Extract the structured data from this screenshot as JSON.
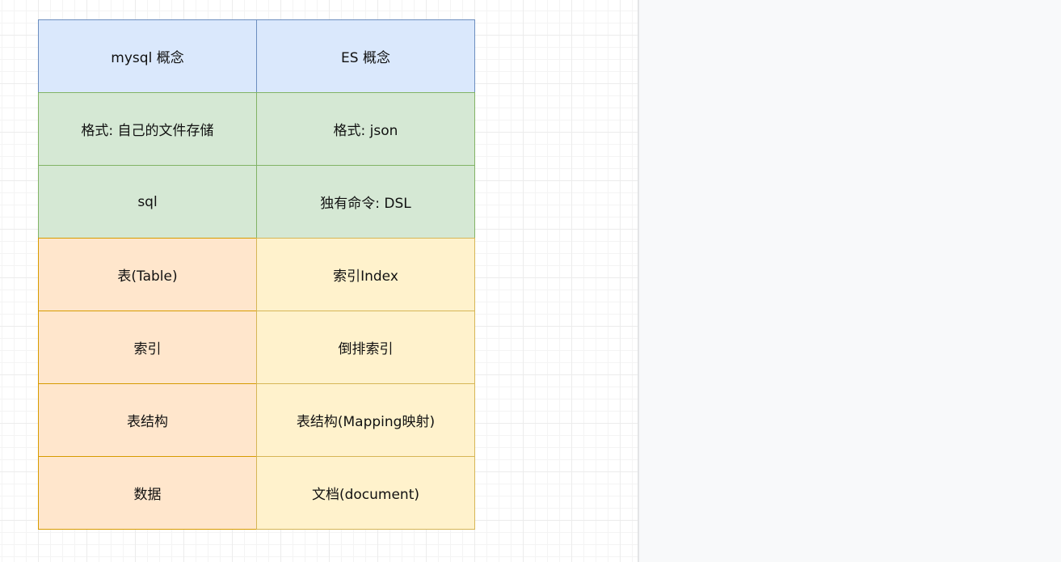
{
  "diagram": {
    "cells": {
      "mysql_header": "mysql  概念",
      "es_header": "ES 概念",
      "mysql_format": "格式: 自己的文件存储",
      "es_format": "格式: json",
      "mysql_command": "sql",
      "es_command": "独有命令: DSL",
      "mysql_table": "表(Table)",
      "es_index": "索引Index",
      "mysql_index": "索引",
      "es_inverted_index": "倒排索引",
      "mysql_schema": "表结构",
      "es_mapping": "表结构(Mapping映射)",
      "mysql_data": "数据",
      "es_document": "文档(document)"
    },
    "colors": {
      "blue_fill": "#dae8fc",
      "blue_stroke": "#6c8ebf",
      "green_fill": "#d5e8d4",
      "green_stroke": "#82b366",
      "orange_fill": "#ffe6cc",
      "orange_stroke": "#d79b00",
      "yellow_fill": "#fff2cc",
      "yellow_stroke": "#d6b656"
    }
  }
}
